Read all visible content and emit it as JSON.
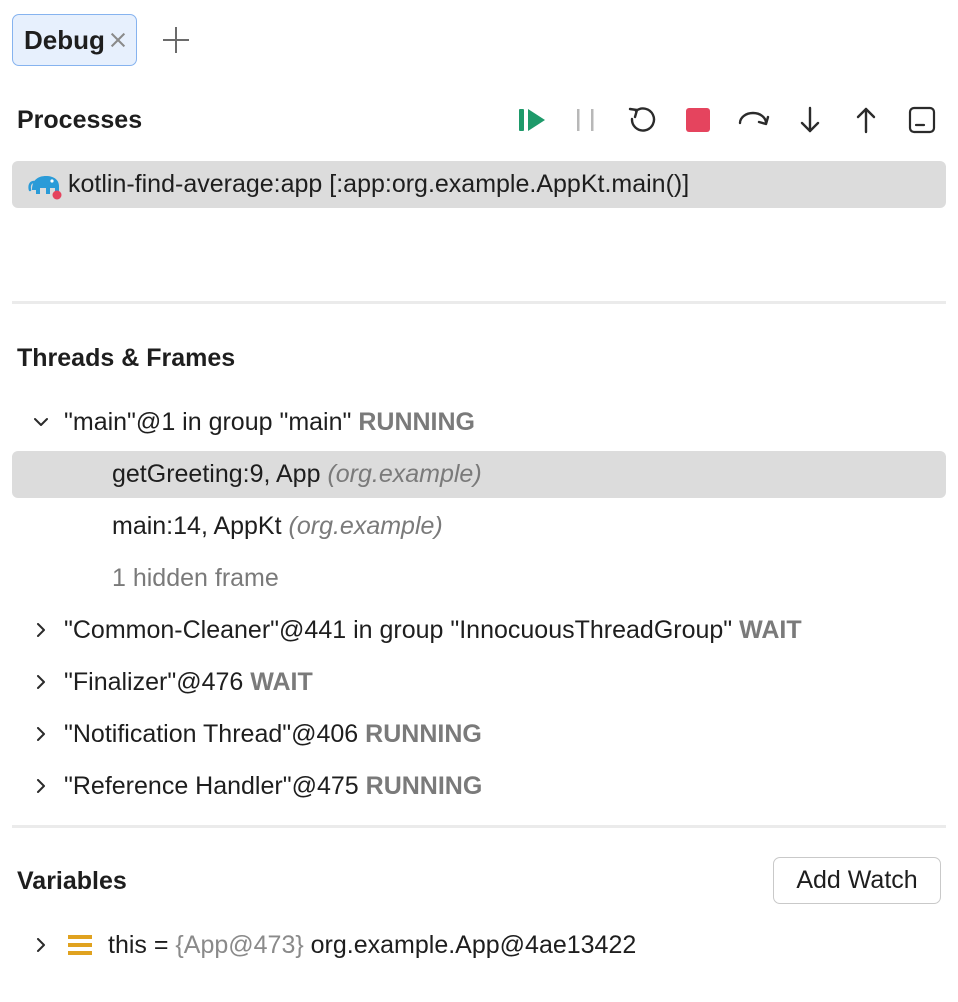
{
  "tabs": [
    {
      "label": "Debug"
    }
  ],
  "processes": {
    "title": "Processes",
    "items": [
      {
        "label": "kotlin-find-average:app [:app:org.example.AppKt.main()]"
      }
    ]
  },
  "toolbar": {
    "buttons": [
      "resume-icon",
      "pause-icon",
      "rerun-icon",
      "stop-icon",
      "step-over-icon",
      "step-into-icon",
      "step-out-icon",
      "restore-layout-icon"
    ],
    "colors": {
      "resume": "#1e9a6a",
      "stop": "#e5445e",
      "pause": "#b8b8b8"
    }
  },
  "threads": {
    "title": "Threads & Frames",
    "items": [
      {
        "name": "\"main\"@1 in group \"main\"",
        "status": "RUNNING",
        "expanded": true
      },
      {
        "name": "\"Common-Cleaner\"@441 in group \"InnocuousThreadGroup\"",
        "status": "WAIT",
        "expanded": false
      },
      {
        "name": "\"Finalizer\"@476",
        "status": "WAIT",
        "expanded": false
      },
      {
        "name": "\"Notification Thread\"@406",
        "status": "RUNNING",
        "expanded": false
      },
      {
        "name": "\"Reference Handler\"@475",
        "status": "RUNNING",
        "expanded": false
      }
    ],
    "frames": [
      {
        "label": "getGreeting:9, App",
        "pkg": "(org.example)",
        "selected": true
      },
      {
        "label": "main:14, AppKt",
        "pkg": "(org.example)",
        "selected": false
      }
    ],
    "hidden_frames": "1 hidden frame"
  },
  "variables": {
    "title": "Variables",
    "add_watch": "Add Watch",
    "items": [
      {
        "name": "this",
        "eq": "=",
        "ref": "{App@473}",
        "value": "org.example.App@4ae13422"
      }
    ]
  }
}
